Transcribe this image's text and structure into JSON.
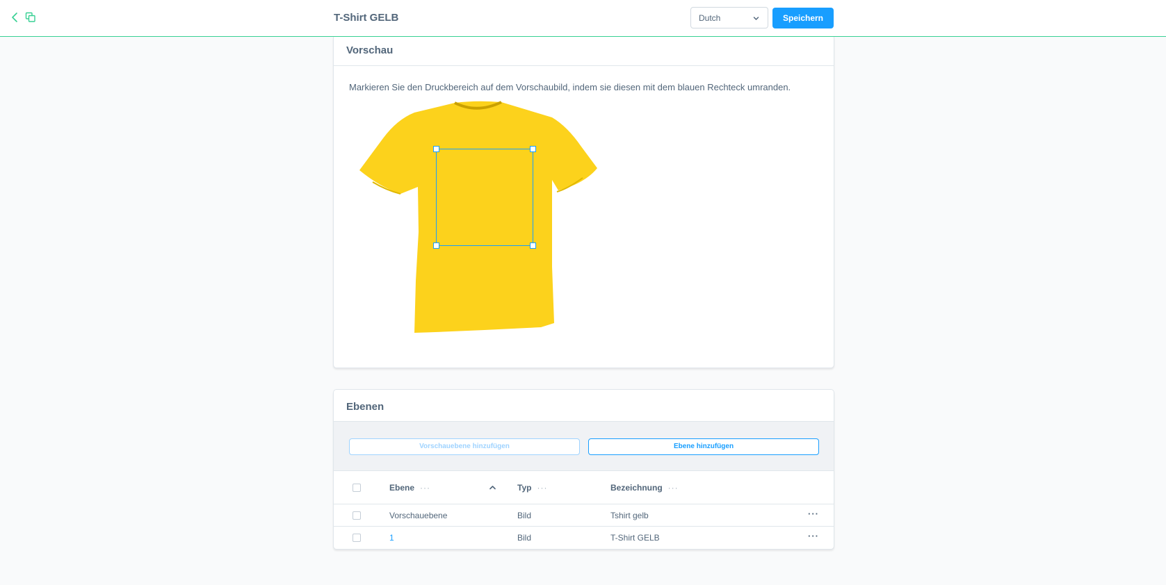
{
  "header": {
    "title": "T-Shirt GELB",
    "language": "Dutch",
    "save_label": "Speichern"
  },
  "preview": {
    "title": "Vorschau",
    "hint": "Markieren Sie den Druckbereich auf dem Vorschaubild, indem sie diesen mit dem blauen Rechteck umranden.",
    "shirt_color": "#fcd21c"
  },
  "layers": {
    "title": "Ebenen",
    "add_preview_label": "Vorschauebene hinzufügen",
    "add_layer_label": "Ebene hinzufügen",
    "columns": {
      "ebene": "Ebene",
      "typ": "Typ",
      "bezeichnung": "Bezeichnung",
      "menu": "···"
    },
    "rows": [
      {
        "ebene": "Vorschauebene",
        "typ": "Bild",
        "bezeichnung": "Tshirt gelb",
        "menu": "···"
      },
      {
        "ebene": "1",
        "typ": "Bild",
        "bezeichnung": "T-Shirt GELB",
        "menu": "···"
      }
    ]
  },
  "colors": {
    "accent": "#189eff",
    "topbar_border": "#37d093"
  }
}
